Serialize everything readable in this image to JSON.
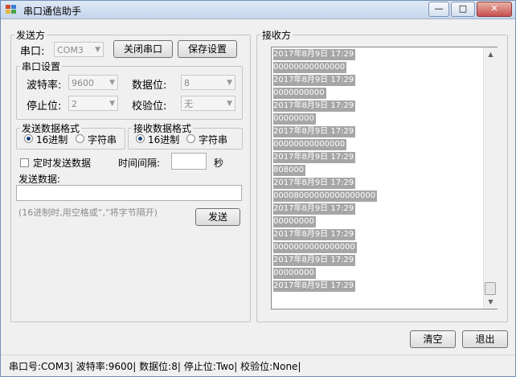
{
  "window": {
    "title": "串口通信助手",
    "controls": {
      "minimize": "—",
      "maximize": "□",
      "close": "✕"
    }
  },
  "send_group": {
    "legend": "发送方",
    "port_label": "串口:",
    "port_value": "COM3",
    "close_port_button": "关闭串口",
    "save_settings_button": "保存设置",
    "serial_settings": {
      "legend": "串口设置",
      "baud_label": "波特率:",
      "baud_value": "9600",
      "data_bits_label": "数据位:",
      "data_bits_value": "8",
      "stop_bits_label": "停止位:",
      "stop_bits_value": "2",
      "parity_label": "校验位:",
      "parity_value": "无"
    },
    "send_format": {
      "legend": "发送数据格式",
      "hex_label": "16进制",
      "string_label": "字符串",
      "selected": "hex"
    },
    "recv_format": {
      "legend": "接收数据格式",
      "hex_label": "16进制",
      "string_label": "字符串",
      "selected": "hex"
    },
    "timed_send_label": "定时发送数据",
    "interval_label": "时间间隔:",
    "interval_value": "",
    "seconds_label": "秒",
    "send_data_label": "发送数据:",
    "send_data_value": "",
    "hint": "(16进制时,用空格或“,”将字节隔开)",
    "send_button": "发送"
  },
  "recv_group": {
    "legend": "接收方",
    "lines": [
      "2017年8月9日 17:29",
      "00000000000000",
      "2017年8月9日 17:29",
      "0000000000",
      "2017年8月9日 17:29",
      "00000000",
      "2017年8月9日 17:29",
      "00000000000000",
      "2017年8月9日 17:29",
      "808000",
      "2017年8月9日 17:29",
      "00008000000000000000",
      "2017年8月9日 17:29",
      "00000000",
      "2017年8月9日 17:29",
      "0000000000000000",
      "2017年8月9日 17:29",
      "00000000",
      "2017年8月9日 17:29"
    ]
  },
  "buttons": {
    "clear": "清空",
    "exit": "退出"
  },
  "status": {
    "text": "串口号:COM3|  波特率:9600|  数据位:8|  停止位:Two|  校验位:None|"
  }
}
